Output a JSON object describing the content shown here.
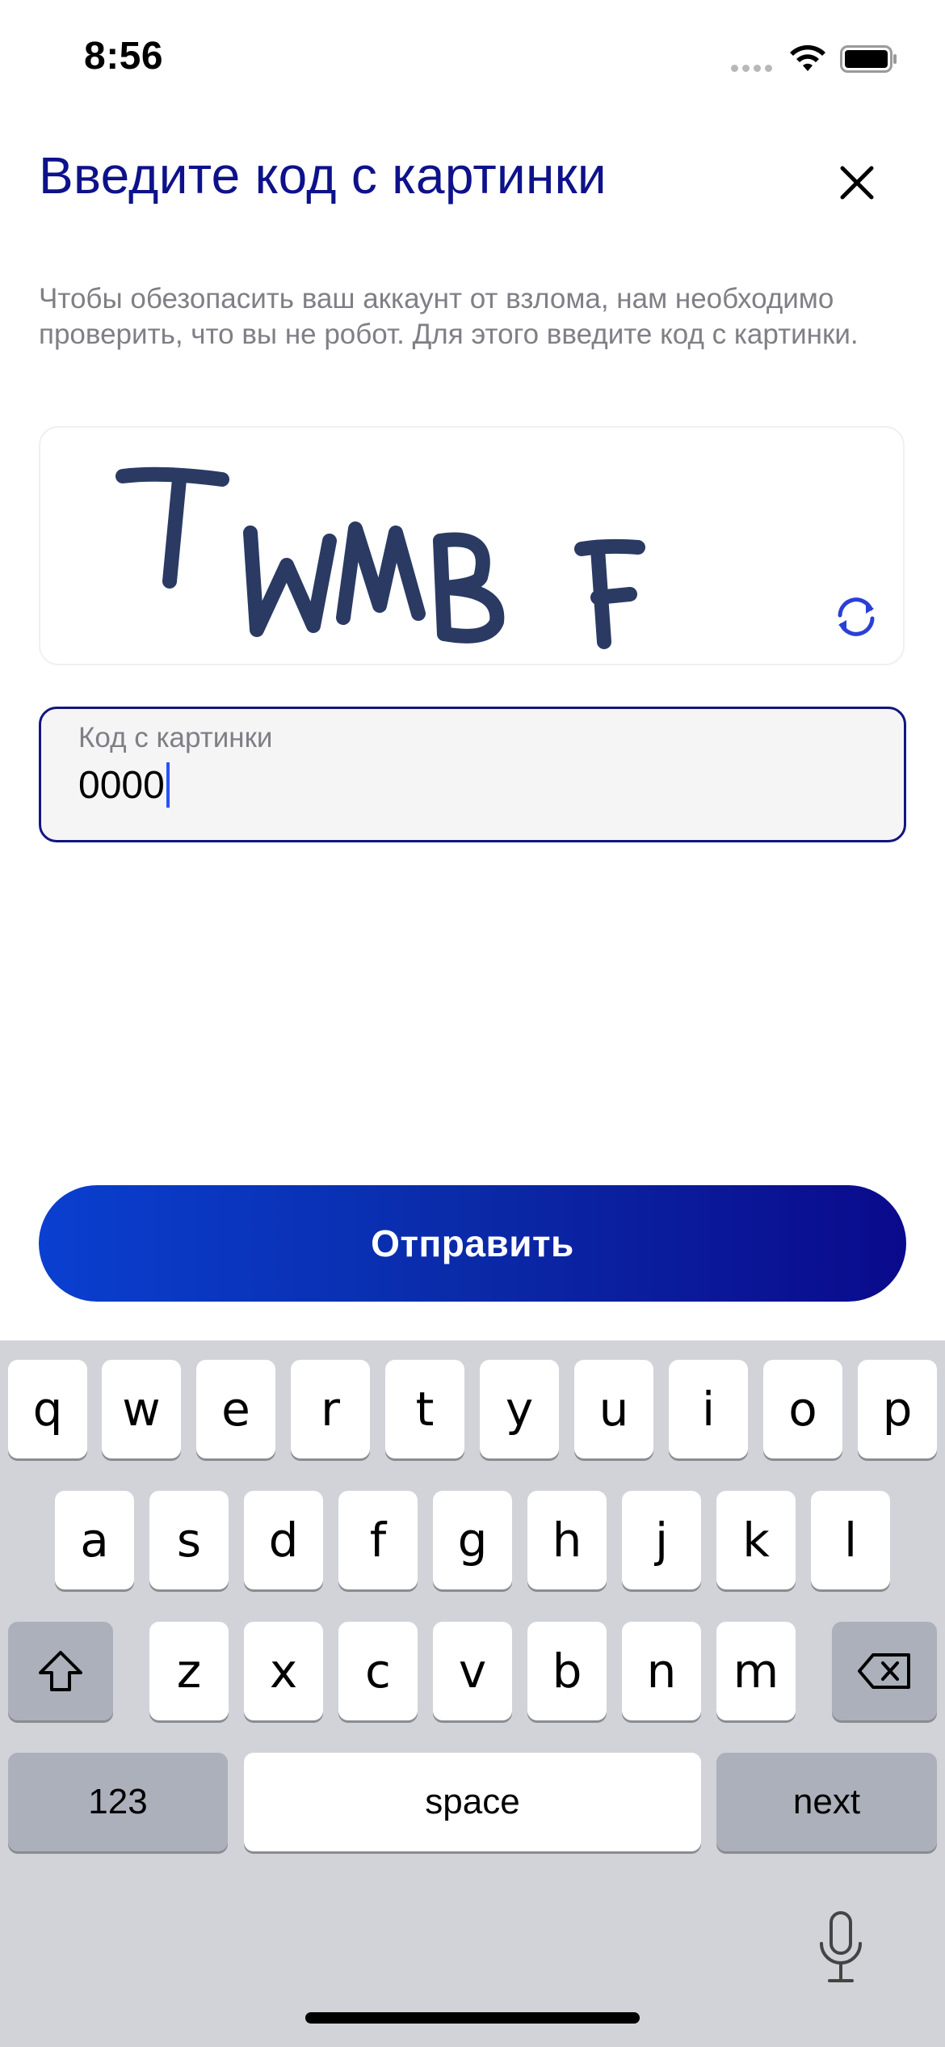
{
  "status_bar": {
    "time": "8:56"
  },
  "header": {
    "title": "Введите код с картинки"
  },
  "description": "Чтобы обезопасить ваш аккаунт от взлома, нам необходимо проверить, что вы не робот. Для этого введите код с картинки.",
  "captcha": {
    "text": "TWMB F"
  },
  "code_field": {
    "label": "Код с картинки",
    "value": "0000"
  },
  "submit_button": {
    "label": "Отправить"
  },
  "keyboard": {
    "row1": [
      "q",
      "w",
      "e",
      "r",
      "t",
      "y",
      "u",
      "i",
      "o",
      "p"
    ],
    "row2": [
      "a",
      "s",
      "d",
      "f",
      "g",
      "h",
      "j",
      "k",
      "l"
    ],
    "row3": [
      "z",
      "x",
      "c",
      "v",
      "b",
      "n",
      "m"
    ],
    "numbers_label": "123",
    "space_label": "space",
    "next_label": "next"
  },
  "colors": {
    "accent": "#0d128a",
    "button_gradient_start": "#0a3fd0",
    "button_gradient_end": "#0a0a8c",
    "refresh_icon": "#2a3fd8",
    "caret": "#2a52ff"
  },
  "icons": {
    "close": "close-icon",
    "refresh": "refresh-icon",
    "shift": "shift-icon",
    "backspace": "backspace-icon",
    "mic": "microphone-icon"
  }
}
